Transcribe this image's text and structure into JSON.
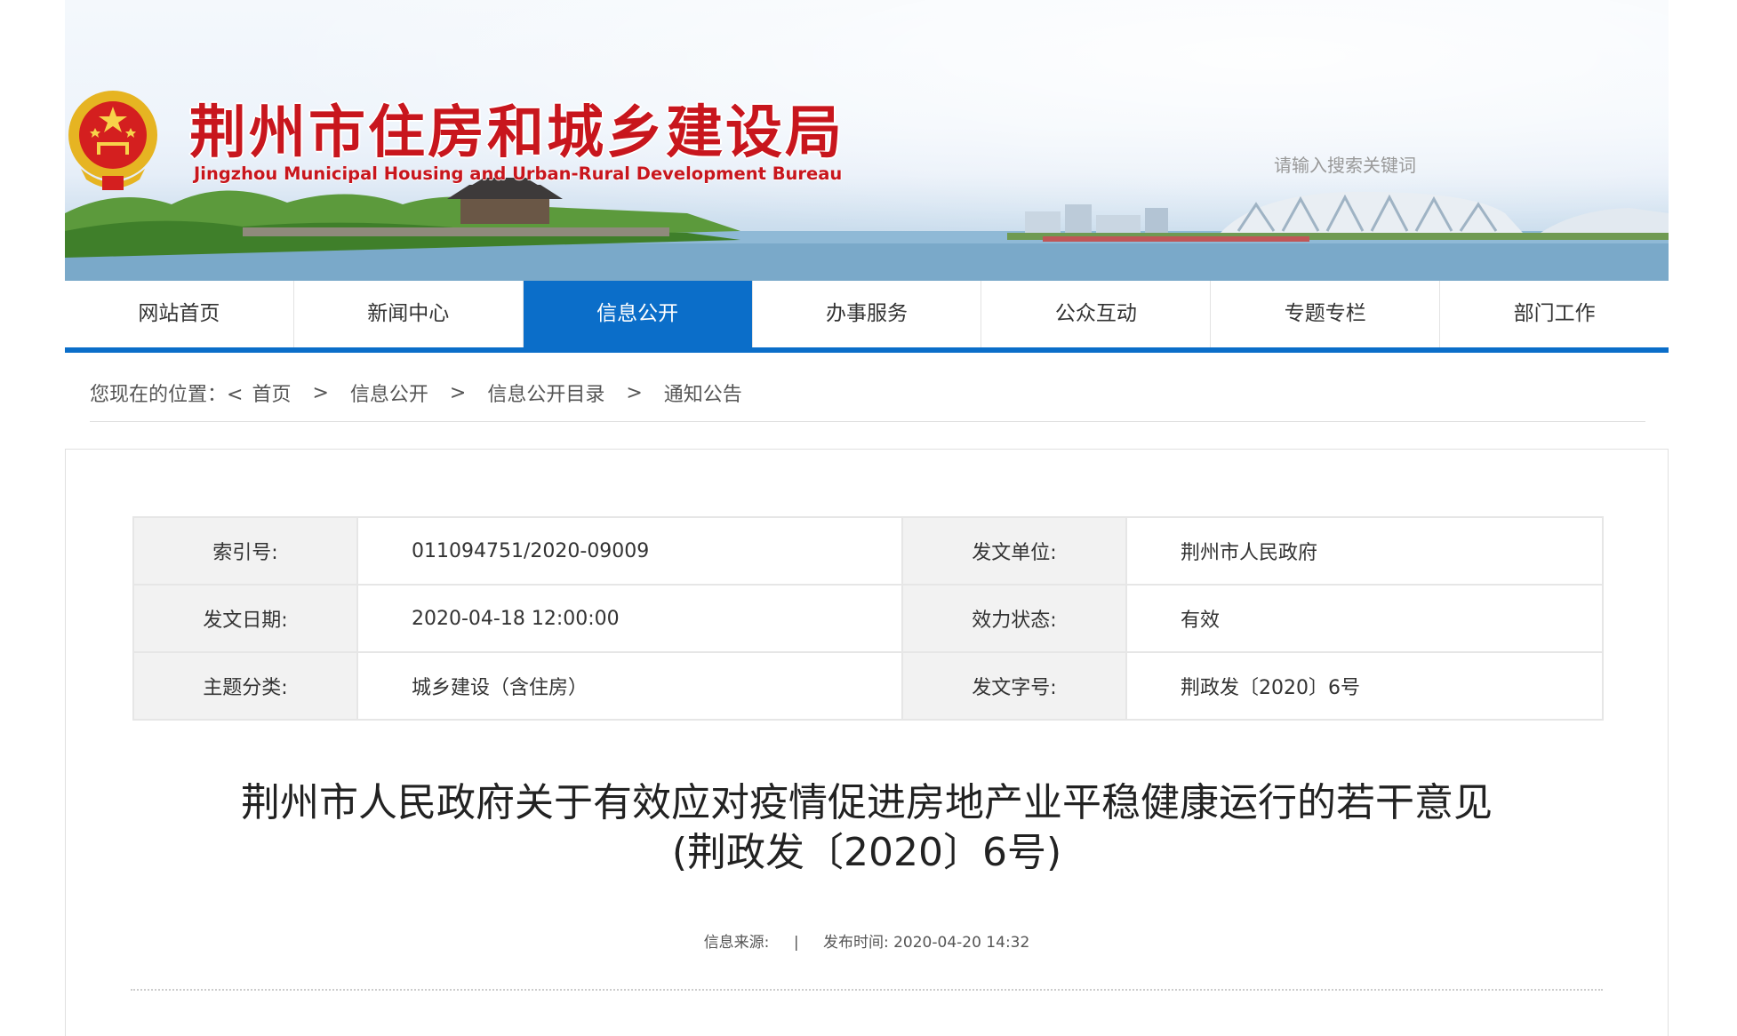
{
  "site": {
    "title_cn": "荆州市住房和城乡建设局",
    "title_en": "Jingzhou Municipal Housing and Urban-Rural Development Bureau",
    "search_placeholder": "请输入搜索关键词"
  },
  "colors": {
    "brand_red": "#c8161d",
    "nav_blue": "#0b6ec9",
    "table_label_bg": "#f2f2f2"
  },
  "icons": {
    "emblem": "national-emblem-icon",
    "search": "search-icon"
  },
  "nav": [
    {
      "label": "网站首页",
      "active": false
    },
    {
      "label": "新闻中心",
      "active": false
    },
    {
      "label": "信息公开",
      "active": true
    },
    {
      "label": "办事服务",
      "active": false
    },
    {
      "label": "公众互动",
      "active": false
    },
    {
      "label": "专题专栏",
      "active": false
    },
    {
      "label": "部门工作",
      "active": false
    }
  ],
  "breadcrumb": {
    "lead": "您现在的位置：<",
    "items": [
      "首页",
      "信息公开",
      "信息公开目录",
      "通知公告"
    ],
    "separator": ">"
  },
  "meta": [
    {
      "k1": "索引号:",
      "v1": "011094751/2020-09009",
      "k2": "发文单位:",
      "v2": "荆州市人民政府"
    },
    {
      "k1": "发文日期:",
      "v1": "2020-04-18 12:00:00",
      "k2": "效力状态:",
      "v2": "有效"
    },
    {
      "k1": "主题分类:",
      "v1": "城乡建设（含住房）",
      "k2": "发文字号:",
      "v2": "荆政发〔2020〕6号"
    }
  ],
  "doc": {
    "title_line1": "荆州市人民政府关于有效应对疫情促进房地产业平稳健康运行的若干意见",
    "title_line2": "(荆政发〔2020〕6号)",
    "source_label": "信息来源:",
    "divider": "|",
    "publish_label": "发布时间:",
    "publish_time": "2020-04-20 14:32"
  }
}
